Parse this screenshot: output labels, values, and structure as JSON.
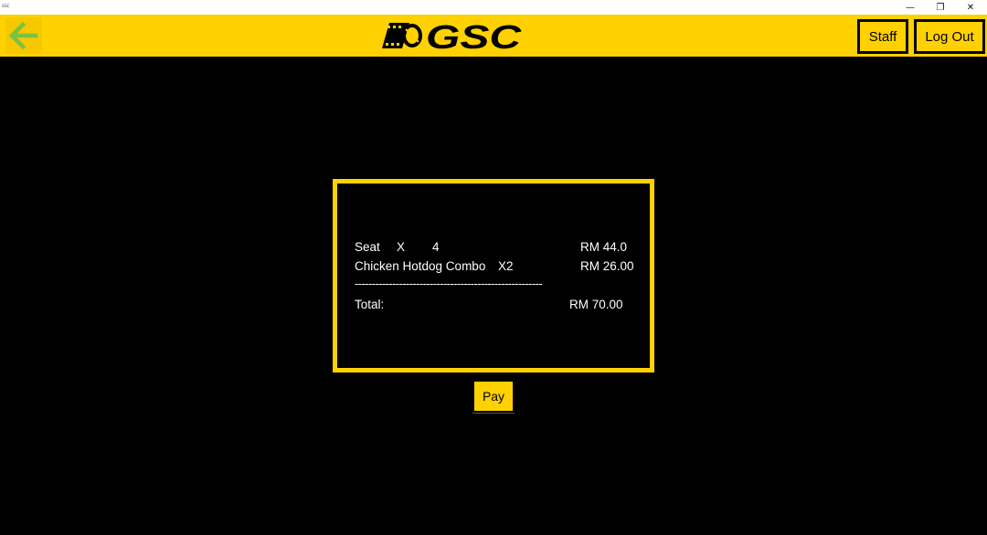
{
  "window": {
    "app_label": "GSC",
    "minimize_glyph": "—",
    "maximize_glyph": "❐",
    "close_glyph": "✕"
  },
  "header": {
    "back_icon": "arrow-left-icon",
    "logo_text": "GSC",
    "staff_label": "Staff",
    "logout_label": "Log Out"
  },
  "receipt": {
    "line1": {
      "item": "Seat",
      "x": "X",
      "qty": "4",
      "price": "RM 44.0"
    },
    "line2": {
      "item": "Chicken Hotdog Combo",
      "x": "X2",
      "price": "RM 26.00"
    },
    "separator": "-------------------------------------------------------",
    "total_label": "Total:",
    "total_value": "RM 70.00"
  },
  "pay_label": "Pay",
  "colors": {
    "accent_yellow": "#ffd100",
    "arrow_green": "#7ac143",
    "background": "#000000"
  }
}
